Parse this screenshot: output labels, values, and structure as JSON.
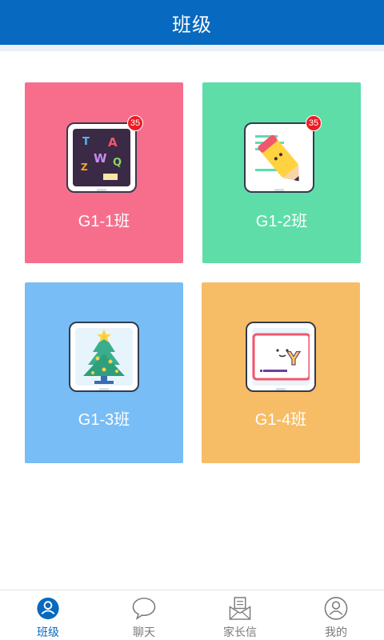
{
  "header": {
    "title": "班级"
  },
  "classes": [
    {
      "name": "G1-1班",
      "badge": "35",
      "color": "#f76e8d",
      "icon": "chalkboard-icon"
    },
    {
      "name": "G1-2班",
      "badge": "35",
      "color": "#5edda9",
      "icon": "pencil-icon"
    },
    {
      "name": "G1-3班",
      "badge": "",
      "color": "#78bdf6",
      "icon": "christmas-tree-icon"
    },
    {
      "name": "G1-4班",
      "badge": "",
      "color": "#f6bd66",
      "icon": "whiteboard-icon"
    }
  ],
  "tabbar": {
    "items": [
      {
        "label": "班级",
        "icon": "class-icon",
        "active": true
      },
      {
        "label": "聊天",
        "icon": "chat-bubble-icon",
        "active": false
      },
      {
        "label": "家长信",
        "icon": "letter-icon",
        "active": false
      },
      {
        "label": "我的",
        "icon": "profile-icon",
        "active": false
      }
    ]
  },
  "colors": {
    "primary": "#0769bf",
    "badge": "#ee1c24"
  }
}
